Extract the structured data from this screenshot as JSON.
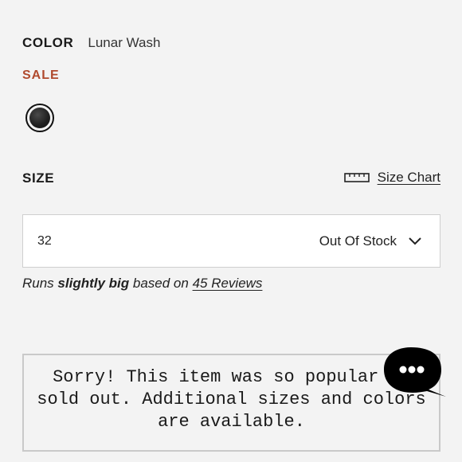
{
  "product": {
    "color_label": "COLOR",
    "color_value": "Lunar Wash",
    "sale_label": "SALE",
    "sale_color": "#b04a2e",
    "swatch_name": "Lunar Wash swatch"
  },
  "size": {
    "label": "SIZE",
    "chart_link": "Size Chart",
    "selected_value": "32",
    "status": "Out Of Stock"
  },
  "fit": {
    "prefix": "Runs ",
    "emphasis": "slightly big",
    "middle": " based on ",
    "reviews_link": "45 Reviews"
  },
  "soldout": {
    "message": "Sorry! This item was so popular it sold out. Additional sizes and colors are available."
  },
  "chat": {
    "icon": "chat-bubble-icon",
    "color": "#000000"
  }
}
